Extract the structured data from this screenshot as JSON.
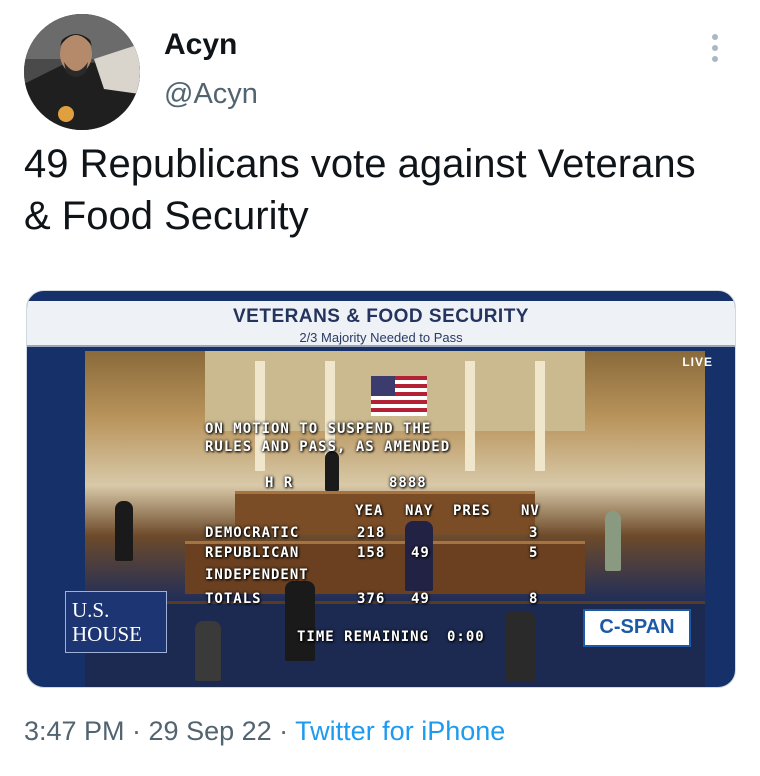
{
  "tweet": {
    "author_name": "Acyn",
    "author_handle": "@Acyn",
    "text": "49 Republicans vote against Veterans & Food Security",
    "timestamp": "3:47 PM · 29 Sep 22",
    "separator": " · ",
    "source": "Twitter for iPhone"
  },
  "media": {
    "banner_title": "VETERANS & FOOD SECURITY",
    "banner_subtitle": "2/3 Majority Needed to Pass",
    "live": "LIVE",
    "motion_line1": "ON MOTION TO SUSPEND THE",
    "motion_line2": "RULES AND PASS, AS AMENDED",
    "bill_label": "H R",
    "bill_number": "8888",
    "headers": {
      "yea": "YEA",
      "nay": "NAY",
      "pres": "PRES",
      "nv": "NV"
    },
    "rows": {
      "democratic": {
        "label": "DEMOCRATIC",
        "yea": "218",
        "nv": "3"
      },
      "republican": {
        "label": "REPUBLICAN",
        "yea": "158",
        "nay": "49",
        "nv": "5"
      },
      "independent": {
        "label": "INDEPENDENT"
      },
      "totals": {
        "label": "TOTALS",
        "yea": "376",
        "nay": "49",
        "nv": "8"
      }
    },
    "time_remaining_label": "TIME REMAINING",
    "time_remaining": "0:00",
    "us_house_line1": "U.S.",
    "us_house_line2": "HOUSE",
    "cspan": "C-SPAN"
  },
  "icons": {
    "more": "more-options-icon"
  }
}
